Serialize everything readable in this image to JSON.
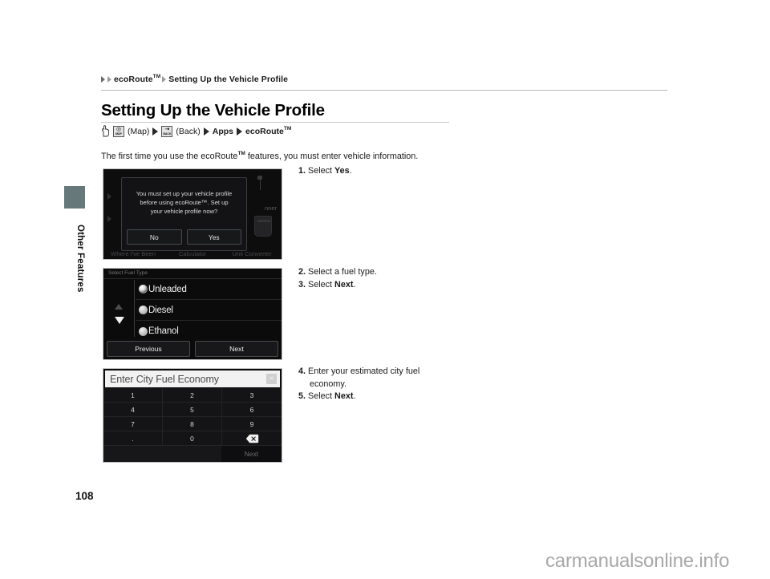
{
  "breadcrumb": {
    "item1": "ecoRoute",
    "item1_tm": "TM",
    "item2": "Setting Up the Vehicle Profile"
  },
  "page_title": "Setting Up the Vehicle Profile",
  "nav_path": {
    "hand_icon": "hand-pointer-icon",
    "map_button_icon": "map-button-icon",
    "map_button_label": "MAP",
    "map_text": "(Map)",
    "back_button_icon": "back-button-icon",
    "back_button_label": "BACK",
    "back_text": "(Back)",
    "apps": "Apps",
    "ecoroute": "ecoRoute",
    "ecoroute_tm": "TM"
  },
  "intro": {
    "part1": "The first time you use the ecoRoute",
    "tm": "TM",
    "part2": " features, you must enter vehicle information."
  },
  "side_tab": {
    "label": "Other Features",
    "color": "#67787a"
  },
  "page_number": "108",
  "watermark": "carmanualsonline.info",
  "screenshot_dialog": {
    "name": "vehicle-profile-prompt",
    "message_line1": "You must set up your vehicle profile",
    "message_line2": "before using ecoRoute™. Set up",
    "message_line3": "your vehicle profile now?",
    "button_no": "No",
    "button_yes": "Yes",
    "background_labels": [
      "Where I've Been",
      "Calculator",
      "Unit Converter"
    ],
    "background_partial_label": "nner"
  },
  "screenshot_fueltype": {
    "title": "Select Fuel Type",
    "options": [
      {
        "label": "Unleaded",
        "selected": true
      },
      {
        "label": "Diesel",
        "selected": false
      },
      {
        "label": "Ethanol",
        "selected": false
      }
    ],
    "button_previous": "Previous",
    "button_next": "Next",
    "scroll_up_icon": "scroll-up-arrow-icon",
    "scroll_down_icon": "scroll-down-arrow-icon"
  },
  "screenshot_keypad": {
    "field_value": "Enter City Fuel Economy",
    "close_icon": "clear-field-icon",
    "keys": [
      "1",
      "2",
      "3",
      "4",
      "5",
      "6",
      "7",
      "8",
      "9",
      ".",
      "0",
      "backspace-icon"
    ],
    "backspace_icon": "backspace-icon",
    "button_next": "Next"
  },
  "steps": {
    "group1": [
      {
        "num": "1.",
        "pre": " Select ",
        "bold": "Yes",
        "post": "."
      }
    ],
    "group2": [
      {
        "num": "2.",
        "pre": " Select a fuel type.",
        "bold": "",
        "post": ""
      },
      {
        "num": "3.",
        "pre": " Select ",
        "bold": "Next",
        "post": "."
      }
    ],
    "group3": [
      {
        "num": "4.",
        "pre": " Enter your estimated city fuel",
        "bold": "",
        "post": "",
        "cont": "economy."
      },
      {
        "num": "5.",
        "pre": " Select ",
        "bold": "Next",
        "post": "."
      }
    ]
  }
}
